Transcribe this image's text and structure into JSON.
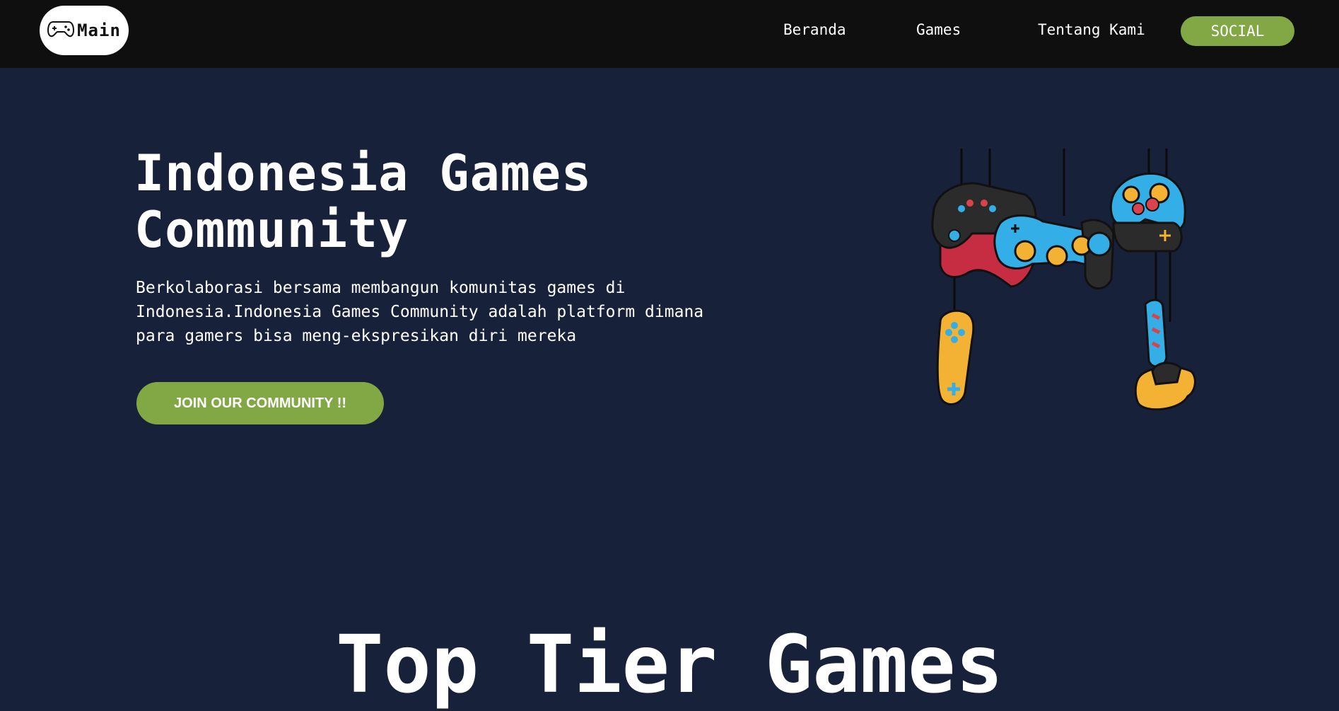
{
  "navbar": {
    "logo_text": "Main",
    "links": [
      {
        "label": "Beranda"
      },
      {
        "label": "Games"
      },
      {
        "label": "Tentang Kami"
      }
    ],
    "social_label": "SOCIAL"
  },
  "hero": {
    "title_line1": "Indonesia Games",
    "title_line2": "Community",
    "description": "Berkolaborasi bersama membangun komunitas games di Indonesia.Indonesia Games Community adalah platform dimana para gamers bisa meng-ekspresikan diri mereka",
    "cta_label": "JOIN OUR COMMUNITY !!"
  },
  "section": {
    "title": "Top Tier Games"
  },
  "colors": {
    "page_background": "#18213a",
    "navbar_background": "#0f0f0f",
    "accent_green": "#82a845",
    "text": "#ffffff"
  },
  "icons": {
    "logo_icon": "gamepad-icon",
    "illustration": "hanging-game-controllers"
  }
}
